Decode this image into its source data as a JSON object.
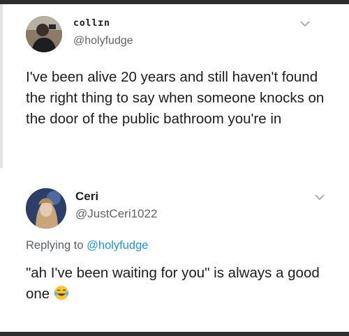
{
  "tweet": {
    "display_name": "collɪn",
    "handle": "@holyfudge",
    "text": "I've been alive 20 years and still haven't found the right thing to say when someone knocks on the door of the public bathroom you're in",
    "avatar_icon": "user-avatar-photo",
    "menu_icon": "chevron-down-icon"
  },
  "reply": {
    "display_name": "Ceri",
    "handle": "@JustCeri1022",
    "replying_label": "Replying to",
    "replying_handle": "@holyfudge",
    "text": "\"ah I've been waiting for you\" is always a good one",
    "emoji": "tears-of-joy-emoji",
    "avatar_icon": "user-avatar-photo",
    "menu_icon": "chevron-down-icon"
  },
  "colors": {
    "link_blue": "#1f93e6",
    "secondary_text": "#606266",
    "frame": "#2e2e2e"
  }
}
